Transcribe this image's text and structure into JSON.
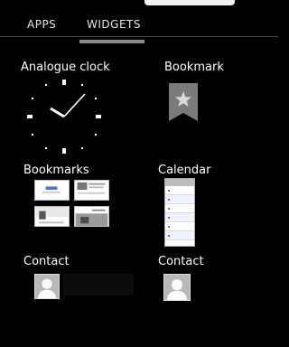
{
  "tabs": {
    "apps": "APPS",
    "widgets": "WIDGETS"
  },
  "widgets": [
    {
      "label": "Analogue clock",
      "icon": "analogue-clock-icon"
    },
    {
      "label": "Bookmark",
      "icon": "bookmark-star-icon"
    },
    {
      "label": "Bookmarks",
      "icon": "bookmarks-thumbnails-icon"
    },
    {
      "label": "Calendar",
      "icon": "calendar-icon"
    },
    {
      "label": "Contact",
      "icon": "contact-avatar-icon"
    },
    {
      "label": "Contact",
      "icon": "contact-avatar-icon"
    }
  ],
  "colors": {
    "background": "#000000",
    "tab_indicator": "#8a8a8a",
    "bookmark_gray": "#7a7a7a"
  }
}
